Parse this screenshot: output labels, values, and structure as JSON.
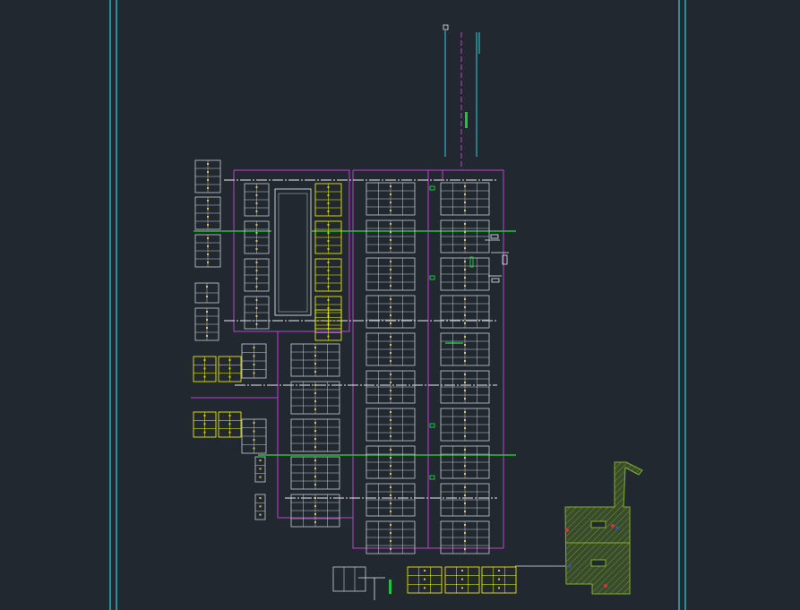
{
  "viewport": {
    "background": "#212830"
  },
  "colors": {
    "frame": "#2fd3e0",
    "boundary": "#c13fd0",
    "cabinet": "#c8ccd2",
    "cabinet_highlight": "#ffff00",
    "accent": "#e0c050",
    "bus": "#22c33a",
    "wiring": "#eaeaea",
    "hatch_fill": "#3a4a2c",
    "hatch_stroke": "#7fb22a",
    "marker_red": "#e03030",
    "marker_blue": "#3050e0"
  },
  "drawing": {
    "title": "",
    "layers": [
      "frame-border",
      "room-boundary",
      "cabinet-rows",
      "power-bus",
      "cable-tray",
      "detail-plan"
    ]
  }
}
